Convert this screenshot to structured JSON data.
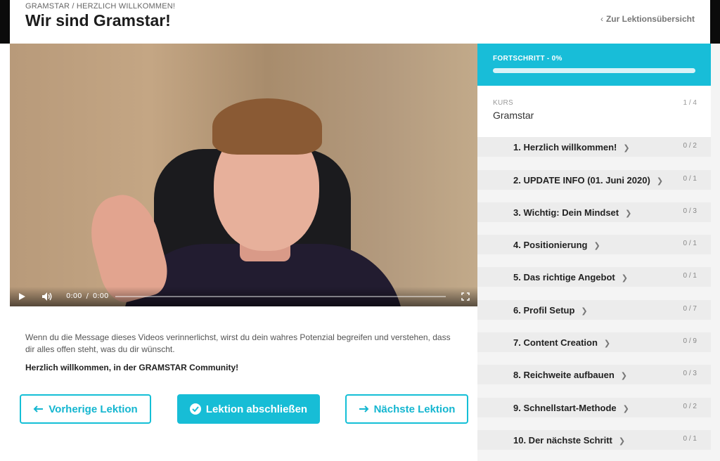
{
  "header": {
    "breadcrumb": "GRAMSTAR / HERZLICH WILLKOMMEN!",
    "title": "Wir sind Gramstar!",
    "back_link": "Zur Lektionsübersicht"
  },
  "video": {
    "current_time": "0:00",
    "duration": "0:00",
    "time_separator": "/",
    "progress": 0
  },
  "content": {
    "description": "Wenn du die Message dieses Videos verinnerlichst, wirst du dein wahres Potenzial begreifen und verstehen, dass dir alles offen steht, was du dir wünscht.",
    "welcome": "Herzlich willkommen, in der GRAMSTAR Community!"
  },
  "buttons": {
    "prev": "Vorherige Lektion",
    "complete": "Lektion abschließen",
    "next": "Nächste Lektion"
  },
  "sidebar": {
    "progress_label": "FORTSCHRITT - 0%",
    "progress_value": 0,
    "course_kicker": "KURS",
    "course_name": "Gramstar",
    "course_count": "1 / 4",
    "lessons": [
      {
        "title": "1. Herzlich willkommen!",
        "count": "0 / 2"
      },
      {
        "title": "2. UPDATE INFO (01. Juni 2020)",
        "count": "0 / 1"
      },
      {
        "title": "3. Wichtig: Dein Mindset",
        "count": "0 / 3"
      },
      {
        "title": "4. Positionierung",
        "count": "0 / 1"
      },
      {
        "title": "5. Das richtige Angebot",
        "count": "0 / 1"
      },
      {
        "title": "6. Profil Setup",
        "count": "0 / 7"
      },
      {
        "title": "7. Content Creation",
        "count": "0 / 9"
      },
      {
        "title": "8. Reichweite aufbauen",
        "count": "0 / 3"
      },
      {
        "title": "9. Schnellstart-Methode",
        "count": "0 / 2"
      },
      {
        "title": "10. Der nächste Schritt",
        "count": "0 / 1"
      }
    ]
  },
  "colors": {
    "accent": "#17bdd6",
    "lesson_bg": "#ececec"
  },
  "icons": {
    "back": "chevron-left-icon",
    "play": "play-icon",
    "volume": "volume-icon",
    "fullscreen": "fullscreen-icon",
    "prev": "arrow-left-icon",
    "complete": "check-circle-icon",
    "next": "arrow-right-icon",
    "lesson": "chevron-right-icon"
  }
}
